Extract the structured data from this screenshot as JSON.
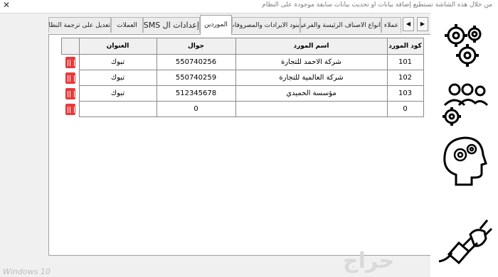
{
  "window": {
    "title": "من خلال هذه الشاشة تستطيع إضافة بيانات او تحديث بيانات سابقة موجودة على النظام",
    "close_glyph": "✕"
  },
  "tabs": [
    {
      "label": "عملاء"
    },
    {
      "label": "انواع الاصناف الرئيسة والفرعيه"
    },
    {
      "label": "بنود الايرادات والمصروفات"
    },
    {
      "label": "الموردين"
    },
    {
      "label": "إعدادات ال SMS"
    },
    {
      "label": "العملات"
    },
    {
      "label": "تعديل على ترجمة النظام"
    }
  ],
  "table": {
    "headers": {
      "code": "كود المورد",
      "name": "اسم المورد",
      "mobile": "جوال",
      "address": "العنوان"
    },
    "rows": [
      {
        "code": "101",
        "name": "شركة الاحمد للتجارة",
        "mobile": "550740256",
        "address": "تبوك"
      },
      {
        "code": "102",
        "name": "شركة العالمية للتجارة",
        "mobile": "550740259",
        "address": "تبوك"
      },
      {
        "code": "103",
        "name": "مؤسسة الحميدي",
        "mobile": "512345678",
        "address": "تبوك"
      },
      {
        "code": "0",
        "name": "",
        "mobile": "0",
        "address": ""
      }
    ]
  },
  "side_icons": [
    "gears-icon",
    "users-settings-icon",
    "head-gears-icon",
    "plug-icon"
  ],
  "footer": {
    "os_watermark": "Windows 10",
    "site_watermark": "حراج"
  },
  "colors": {
    "delete_red": "#e63b3b",
    "active_tab": "#ffffff"
  }
}
